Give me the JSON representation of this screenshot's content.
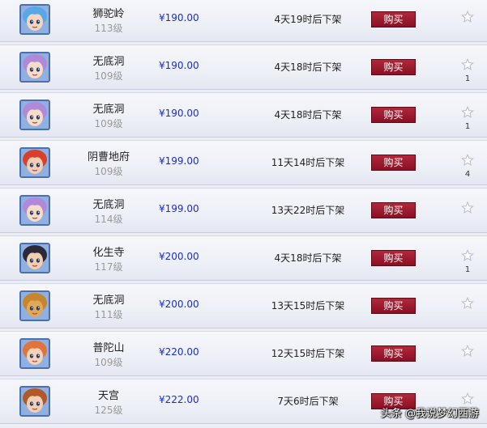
{
  "currency": "¥",
  "buy_label": "购买",
  "listings": [
    {
      "school": "狮驼岭",
      "level": "113级",
      "price": "¥190.00",
      "expiry": "4天19时后下架",
      "favorites": "",
      "avatar": "blue-haired-character",
      "hair": "#5aa7e8",
      "skin": "#f2d6c2"
    },
    {
      "school": "无底洞",
      "level": "109级",
      "price": "¥190.00",
      "expiry": "4天18时后下架",
      "favorites": "1",
      "avatar": "purple-haired-girl",
      "hair": "#b08ad8",
      "skin": "#f7dcc7"
    },
    {
      "school": "无底洞",
      "level": "109级",
      "price": "¥190.00",
      "expiry": "4天18时后下架",
      "favorites": "1",
      "avatar": "purple-haired-girl",
      "hair": "#b08ad8",
      "skin": "#f7dcc7"
    },
    {
      "school": "阴曹地府",
      "level": "109级",
      "price": "¥199.00",
      "expiry": "11天14时后下架",
      "favorites": "4",
      "avatar": "red-haired-character",
      "hair": "#d8402c",
      "skin": "#f3cdb4"
    },
    {
      "school": "无底洞",
      "level": "114级",
      "price": "¥199.00",
      "expiry": "13天22时后下架",
      "favorites": "",
      "avatar": "purple-haired-girl",
      "hair": "#b08ad8",
      "skin": "#f7dcc7"
    },
    {
      "school": "化生寺",
      "level": "117级",
      "price": "¥200.00",
      "expiry": "4天18时后下架",
      "favorites": "1",
      "avatar": "dark-haired-boy",
      "hair": "#2a2a3a",
      "skin": "#f2cfae"
    },
    {
      "school": "无底洞",
      "level": "111级",
      "price": "¥200.00",
      "expiry": "13天15时后下架",
      "favorites": "",
      "avatar": "tiger-character",
      "hair": "#c8862c",
      "skin": "#e0a85a"
    },
    {
      "school": "普陀山",
      "level": "109级",
      "price": "¥220.00",
      "expiry": "12天15时后下架",
      "favorites": "",
      "avatar": "flower-crown-girl",
      "hair": "#e0743a",
      "skin": "#f5d2b8"
    },
    {
      "school": "天宫",
      "level": "125级",
      "price": "¥222.00",
      "expiry": "7天6时后下架",
      "favorites": "",
      "avatar": "crowned-character",
      "hair": "#b05a2a",
      "skin": "#f3cfb3"
    }
  ],
  "watermark": "头条 @我说梦幻西游",
  "colors": {
    "price": "#1a2ec8",
    "buy_button": "#9a1a2e",
    "avatar_border": "#4a70b0"
  }
}
